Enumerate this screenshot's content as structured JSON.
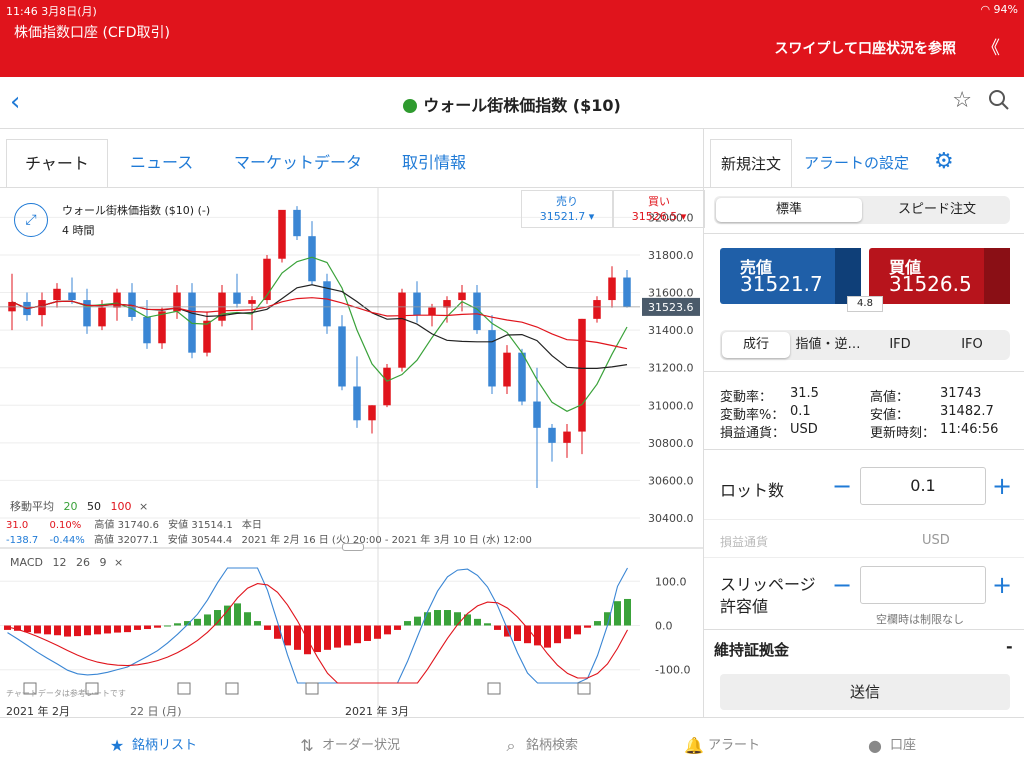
{
  "status_bar": {
    "time_date": "11:46   3月8日(月)",
    "right": "94%"
  },
  "header": {
    "account": "株価指数口座 (CFD取引)",
    "swipe_text": "スワイプして口座状況を参照",
    "collapse": "《"
  },
  "nav": {
    "title": "ウォール街株価指数 ($10)"
  },
  "tabs": [
    "チャート",
    "ニュース",
    "マーケットデータ",
    "取引情報"
  ],
  "chart_header": {
    "name": "ウォール街株価指数 ($10) (-)",
    "period": "4 時間"
  },
  "quote": {
    "sell_label": "売り",
    "sell_value": "31521.7",
    "buy_label": "買い",
    "buy_value": "31526.5"
  },
  "ma_legend": {
    "label": "移動平均",
    "p1": "20",
    "p2": "50",
    "p3": "100"
  },
  "stats": {
    "row1": {
      "change": "31.0",
      "pct": "0.10%",
      "high_l": "高値",
      "high": "31740.6",
      "low_l": "安値",
      "low": "31514.1",
      "period": "本日"
    },
    "row2": {
      "change": "-138.7",
      "pct": "-0.44%",
      "high_l": "高値",
      "high": "32077.1",
      "low_l": "安値",
      "low": "30544.4",
      "period": "2021 年 2月 16 日 (火) 20:00 - 2021 年 3月 10 日 (水) 12:00"
    }
  },
  "macd": {
    "label": "MACD",
    "p1": "12",
    "p2": "26",
    "p3": "9",
    "note": "チャートデータは参考レートです"
  },
  "x_axis": {
    "t1": "2021 年 2月",
    "t2": "22 日 (月)",
    "t3": "2021 年 3月"
  },
  "price_axis": [
    "32000.0",
    "31800.0",
    "31600.0",
    "31400.0",
    "31200.0",
    "31000.0",
    "30800.0",
    "30600.0",
    "30400.0"
  ],
  "current_price": "31523.6",
  "macd_axis": [
    "100.0",
    "0.0",
    "-100.0"
  ],
  "chart_data": {
    "type": "candlestick",
    "title": "ウォール街株価指数 ($10) (-)",
    "interval": "4 時間",
    "ylim": [
      30400,
      32050
    ],
    "ohlc_approx": [
      [
        31500,
        31700,
        31400,
        31550
      ],
      [
        31550,
        31600,
        31450,
        31480
      ],
      [
        31480,
        31600,
        31420,
        31560
      ],
      [
        31560,
        31650,
        31520,
        31620
      ],
      [
        31600,
        31680,
        31540,
        31560
      ],
      [
        31560,
        31620,
        31380,
        31420
      ],
      [
        31420,
        31560,
        31400,
        31520
      ],
      [
        31520,
        31620,
        31450,
        31600
      ],
      [
        31600,
        31650,
        31450,
        31470
      ],
      [
        31470,
        31560,
        31300,
        31330
      ],
      [
        31330,
        31520,
        31300,
        31500
      ],
      [
        31500,
        31640,
        31460,
        31600
      ],
      [
        31600,
        31650,
        31250,
        31280
      ],
      [
        31280,
        31500,
        31260,
        31450
      ],
      [
        31450,
        31640,
        31420,
        31600
      ],
      [
        31600,
        31700,
        31520,
        31540
      ],
      [
        31540,
        31580,
        31400,
        31560
      ],
      [
        31560,
        31800,
        31540,
        31780
      ],
      [
        31780,
        31980,
        31760,
        32040
      ],
      [
        32040,
        32060,
        31880,
        31900
      ],
      [
        31900,
        31980,
        31640,
        31660
      ],
      [
        31660,
        31700,
        31380,
        31420
      ],
      [
        31420,
        31480,
        31080,
        31100
      ],
      [
        31100,
        31260,
        30880,
        30920
      ],
      [
        30920,
        31000,
        30850,
        31000
      ],
      [
        31000,
        31220,
        30990,
        31200
      ],
      [
        31200,
        31620,
        31180,
        31600
      ],
      [
        31600,
        31660,
        31440,
        31480
      ],
      [
        31480,
        31540,
        31420,
        31520
      ],
      [
        31520,
        31580,
        31440,
        31560
      ],
      [
        31560,
        31640,
        31500,
        31600
      ],
      [
        31600,
        31640,
        31380,
        31400
      ],
      [
        31400,
        31480,
        31060,
        31100
      ],
      [
        31100,
        31320,
        31060,
        31280
      ],
      [
        31280,
        31300,
        31000,
        31020
      ],
      [
        31020,
        31200,
        30560,
        30880
      ],
      [
        30880,
        30900,
        30700,
        30800
      ],
      [
        30800,
        30900,
        30720,
        30860
      ],
      [
        30860,
        31460,
        30740,
        31460
      ],
      [
        31460,
        31580,
        31440,
        31560
      ],
      [
        31560,
        31740,
        31520,
        31680
      ],
      [
        31680,
        31720,
        31520,
        31524
      ]
    ],
    "moving_averages": [
      {
        "name": "20",
        "color": "#3aa23a"
      },
      {
        "name": "50",
        "color": "#222222"
      },
      {
        "name": "100",
        "color": "#e0141c"
      }
    ],
    "macd": {
      "fast": 12,
      "slow": 26,
      "signal": 9,
      "ylim": [
        -130,
        130
      ],
      "histogram": [
        -10,
        -12,
        -15,
        -18,
        -20,
        -22,
        -25,
        -24,
        -22,
        -20,
        -18,
        -16,
        -15,
        -10,
        -8,
        -5,
        0,
        5,
        10,
        15,
        25,
        35,
        45,
        50,
        30,
        10,
        -10,
        -30,
        -45,
        -55,
        -65,
        -60,
        -55,
        -50,
        -45,
        -40,
        -35,
        -30,
        -20,
        -10,
        10,
        20,
        30,
        35,
        35,
        30,
        25,
        15,
        5,
        -10,
        -25,
        -35,
        -40,
        -45,
        -50,
        -40,
        -30,
        -20,
        -5,
        10,
        30,
        55,
        60
      ]
    }
  },
  "panel": {
    "tab_order": "新規注文",
    "tab_alert": "アラートの設定",
    "seg1": [
      "標準",
      "スピード注文"
    ],
    "sell": {
      "label": "売値",
      "value": "31521.7"
    },
    "buy": {
      "label": "買値",
      "value": "31526.5"
    },
    "spread": "4.8",
    "order_types": [
      "成行",
      "指値・逆…",
      "IFD",
      "IFO"
    ],
    "info": [
      {
        "k": "変動率：",
        "v": "31.5",
        "k2": "高値：",
        "v2": "31743"
      },
      {
        "k": "変動率%：",
        "v": "0.1",
        "k2": "安値：",
        "v2": "31482.7"
      },
      {
        "k": "損益通貨：",
        "v": "USD",
        "k2": "更新時刻：",
        "v2": "11:46:56"
      }
    ],
    "lot_label": "ロット数",
    "lot_value": "0.1",
    "pnl_currency_label": "損益通貨",
    "pnl_currency": "USD",
    "slippage_label": "スリッページ\n許容値",
    "slippage_note": "空欄時は制限なし",
    "margin_label": "維持証拠金",
    "margin_value": "-",
    "submit": "送信"
  },
  "tabbar": [
    "銘柄リスト",
    "オーダー状況",
    "銘柄検索",
    "アラート",
    "口座"
  ]
}
